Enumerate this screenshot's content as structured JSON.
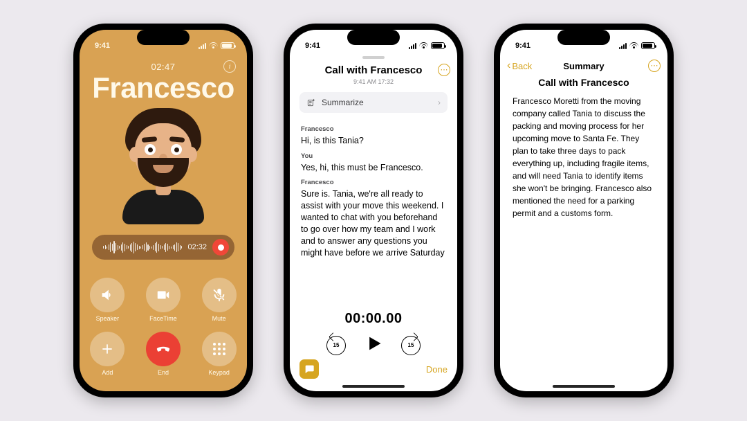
{
  "status": {
    "time": "9:41"
  },
  "call": {
    "duration": "02:47",
    "name": "Francesco",
    "recording_time": "02:32",
    "controls": {
      "speaker": "Speaker",
      "facetime": "FaceTime",
      "mute": "Mute",
      "add": "Add",
      "end": "End",
      "keypad": "Keypad"
    }
  },
  "transcript": {
    "title": "Call with Francesco",
    "meta": "9:41 AM  17:32",
    "summarize_label": "Summarize",
    "turns": [
      {
        "speaker": "Francesco",
        "text": "Hi, is this Tania?"
      },
      {
        "speaker": "You",
        "text": "Yes, hi, this must be Francesco."
      },
      {
        "speaker": "Francesco",
        "text": "Sure is. Tania, we're all ready to assist with your move this weekend. I wanted to chat with you beforehand to go over how my team and I work and to answer any questions you might have before we arrive Saturday"
      }
    ],
    "player_time": "00:00.00",
    "skip_seconds": "15",
    "done_label": "Done"
  },
  "summary": {
    "back_label": "Back",
    "header": "Summary",
    "title": "Call with Francesco",
    "body": "Francesco Moretti from the moving company called Tania to discuss the packing and moving process for her upcoming move to Santa Fe. They plan to take three days to pack everything up, including fragile items, and will need Tania to identify items she won't be bringing. Francesco also mentioned the need for a parking permit and a customs form."
  }
}
